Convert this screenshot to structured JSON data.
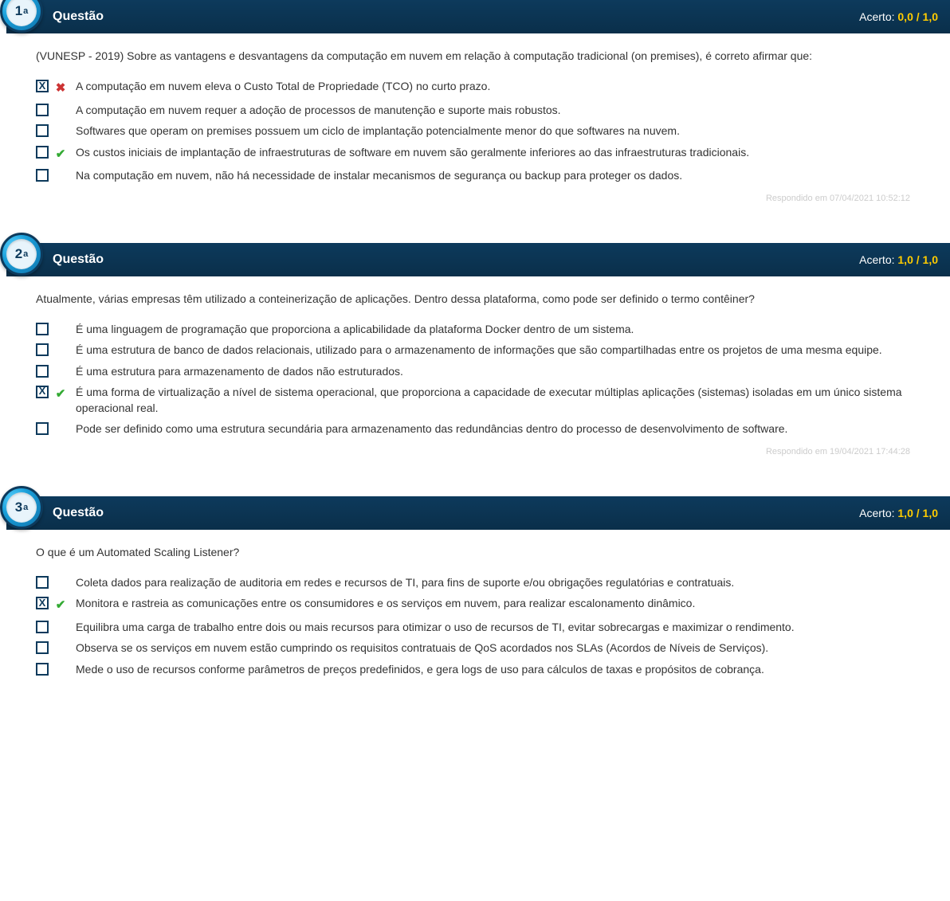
{
  "common": {
    "questionLabel": "Questão",
    "scoreLabel": "Acerto:"
  },
  "questions": [
    {
      "number": "1",
      "ord": "a",
      "scoreEarned": "0,0",
      "scoreTotal": "1,0",
      "earnedClass": "zero",
      "prompt": "(VUNESP - 2019) Sobre as vantagens e desvantagens da computação em nuvem em relação à computação tradicional (on premises), é correto afirmar que:",
      "options": [
        {
          "checked": true,
          "mark": "wrong",
          "text": "A computação em nuvem eleva o Custo Total de Propriedade (TCO) no curto prazo."
        },
        {
          "checked": false,
          "mark": "",
          "text": "A computação em nuvem requer a adoção de processos de manutenção e suporte mais robustos."
        },
        {
          "checked": false,
          "mark": "",
          "text": "Softwares que operam on premises possuem um ciclo de implantação potencialmente menor do que softwares na nuvem."
        },
        {
          "checked": false,
          "mark": "right",
          "text": "Os custos iniciais de implantação de infraestruturas de software em nuvem são geralmente inferiores ao das infraestruturas tradicionais."
        },
        {
          "checked": false,
          "mark": "",
          "text": "Na computação em nuvem, não há necessidade de instalar mecanismos de segurança ou backup para proteger os dados."
        }
      ],
      "timestamp": "Respondido em 07/04/2021 10:52:12"
    },
    {
      "number": "2",
      "ord": "a",
      "scoreEarned": "1,0",
      "scoreTotal": "1,0",
      "earnedClass": "full",
      "prompt": "Atualmente, várias empresas têm utilizado a conteinerização de aplicações. Dentro dessa plataforma, como pode ser definido o termo contêiner?",
      "options": [
        {
          "checked": false,
          "mark": "",
          "text": "É uma linguagem de programação que proporciona a aplicabilidade da plataforma Docker dentro de um sistema."
        },
        {
          "checked": false,
          "mark": "",
          "text": "É uma estrutura de banco de dados relacionais, utilizado para o armazenamento de informações que são compartilhadas entre os projetos de uma mesma equipe."
        },
        {
          "checked": false,
          "mark": "",
          "text": "É uma estrutura para armazenamento de dados não estruturados."
        },
        {
          "checked": true,
          "mark": "right",
          "text": "É uma forma de virtualização a nível de sistema operacional, que proporciona a capacidade de executar múltiplas aplicações (sistemas) isoladas em um único sistema operacional real."
        },
        {
          "checked": false,
          "mark": "",
          "text": "Pode ser definido como uma estrutura secundária para armazenamento das redundâncias dentro do processo de desenvolvimento de software."
        }
      ],
      "timestamp": "Respondido em 19/04/2021 17:44:28"
    },
    {
      "number": "3",
      "ord": "a",
      "scoreEarned": "1,0",
      "scoreTotal": "1,0",
      "earnedClass": "full",
      "prompt": "O que é um Automated Scaling Listener?",
      "options": [
        {
          "checked": false,
          "mark": "",
          "text": "Coleta dados para realização de auditoria em redes e recursos de TI, para fins de suporte e/ou obrigações regulatórias e contratuais."
        },
        {
          "checked": true,
          "mark": "right",
          "text": "Monitora e rastreia as comunicações entre os consumidores e os serviços em nuvem, para realizar escalonamento dinâmico."
        },
        {
          "checked": false,
          "mark": "",
          "text": "Equilibra uma carga de trabalho entre dois ou mais recursos para otimizar o uso de recursos de TI, evitar sobrecargas e maximizar o rendimento."
        },
        {
          "checked": false,
          "mark": "",
          "text": "Observa se os serviços em nuvem estão cumprindo os requisitos contratuais de QoS acordados nos SLAs (Acordos de Níveis de Serviços)."
        },
        {
          "checked": false,
          "mark": "",
          "text": "Mede o uso de recursos conforme parâmetros de preços predefinidos, e gera logs de uso para cálculos de taxas e propósitos de cobrança."
        }
      ],
      "timestamp": ""
    }
  ]
}
